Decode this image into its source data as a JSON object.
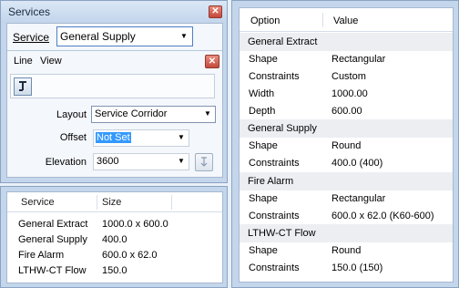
{
  "services_palette": {
    "title": "Services",
    "service_label": "Service",
    "service_value": "General Supply",
    "menu": [
      "Line",
      "View"
    ],
    "layout_label": "Layout",
    "layout_value": "Service Corridor",
    "offset_label": "Offset",
    "offset_value": "Not Set",
    "elevation_label": "Elevation",
    "elevation_value": "3600"
  },
  "size_table": {
    "columns": [
      "Service",
      "Size"
    ],
    "rows": [
      {
        "service": "General Extract",
        "size": "1000.0 x 600.0"
      },
      {
        "service": "General Supply",
        "size": "400.0"
      },
      {
        "service": "Fire Alarm",
        "size": "600.0 x 62.0"
      },
      {
        "service": "LTHW-CT Flow",
        "size": "150.0"
      }
    ]
  },
  "properties": {
    "columns": [
      "Option",
      "Value"
    ],
    "groups": [
      {
        "name": "General Extract",
        "rows": [
          {
            "option": "Shape",
            "value": "Rectangular"
          },
          {
            "option": "Constraints",
            "value": "Custom"
          },
          {
            "option": "Width",
            "value": "1000.00"
          },
          {
            "option": "Depth",
            "value": "600.00"
          }
        ]
      },
      {
        "name": "General Supply",
        "rows": [
          {
            "option": "Shape",
            "value": "Round"
          },
          {
            "option": "Constraints",
            "value": "400.0 (400)"
          }
        ]
      },
      {
        "name": "Fire Alarm",
        "rows": [
          {
            "option": "Shape",
            "value": "Rectangular"
          },
          {
            "option": "Constraints",
            "value": "600.0 x 62.0 (K60-600)"
          }
        ]
      },
      {
        "name": "LTHW-CT Flow",
        "rows": [
          {
            "option": "Shape",
            "value": "Round"
          },
          {
            "option": "Constraints",
            "value": "150.0 (150)"
          }
        ]
      }
    ]
  },
  "colors": {
    "selection": "#3399ff",
    "close_button": "#c5473a",
    "panel_background": "#c4d6ec"
  },
  "icons": [
    "close-icon",
    "dropdown-arrow-icon",
    "line-tool-icon",
    "pick-elevation-icon"
  ]
}
